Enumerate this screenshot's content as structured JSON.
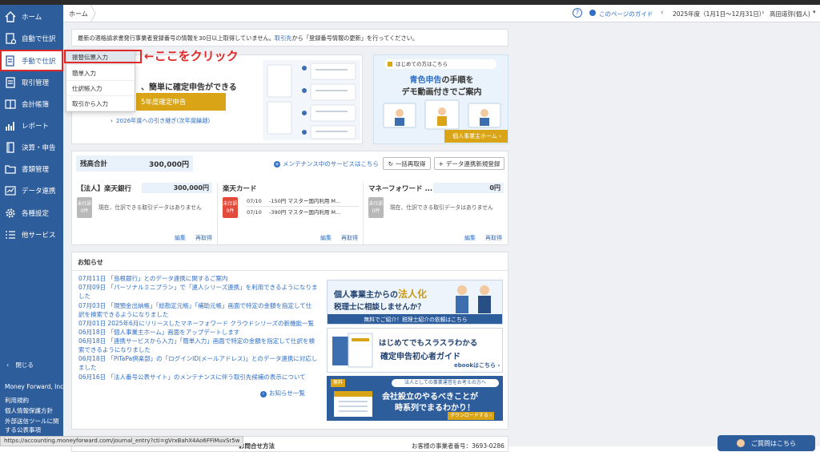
{
  "sidebar": {
    "items": [
      {
        "label": "ホーム",
        "icon": "home-icon"
      },
      {
        "label": "自動で仕訳",
        "icon": "auto-journal-icon"
      },
      {
        "label": "手動で仕訳",
        "icon": "manual-journal-icon"
      },
      {
        "label": "取引管理",
        "icon": "transaction-icon"
      },
      {
        "label": "会計帳簿",
        "icon": "ledger-icon"
      },
      {
        "label": "レポート",
        "icon": "report-icon"
      },
      {
        "label": "決算・申告",
        "icon": "settlement-icon"
      },
      {
        "label": "書類管理",
        "icon": "folder-icon"
      },
      {
        "label": "データ連携",
        "icon": "data-link-icon"
      },
      {
        "label": "各種設定",
        "icon": "gear-icon"
      },
      {
        "label": "他サービス",
        "icon": "list-icon"
      }
    ],
    "close_label": "閉じる",
    "company": "Money Forward, Inc.",
    "footer_links": [
      "利用規約",
      "個人情報保護方針",
      "外部送信ツールに関",
      "する公表事項"
    ]
  },
  "header": {
    "breadcrumb": "ホーム",
    "guide_label": "このページのガイド",
    "fiscal_year": "2025年度（1月1日〜12月31日）",
    "user": "高田道弥(個人)"
  },
  "notice": {
    "text_before": "最新の適格請求書発行事業者登録番号の情報を30日以上取得していません。",
    "link": "取引先",
    "text_after": "から「登録番号情報の更新」を行ってください。"
  },
  "dropdown": {
    "items": [
      "振替伝票入力",
      "簡単入力",
      "仕訳帳入力",
      "取引から入力"
    ]
  },
  "annotation": {
    "text": "←ここをクリック"
  },
  "tax_card": {
    "headline": "、簡単に確定申告ができる",
    "button": "5年度確定申告",
    "link": "2026年度への引き継ぎ(次年度繰越)"
  },
  "promo": {
    "tag": "はじめての方はこちら",
    "line1_hl": "青色申告",
    "line1_rest": "の手順を",
    "line2": "デモ動画付きでご案内",
    "button": "個人事業主ホーム ›"
  },
  "balance": {
    "label": "残高合計",
    "total": "300,000円",
    "maintenance": "メンテナンス中のサービスはこちら",
    "fetch_all": "一括再取得",
    "new_link": "データ連携新規登録"
  },
  "accounts": [
    {
      "name": "【法人】楽天銀行",
      "amount": "300,000円",
      "badge": [
        "未仕訳",
        "0件"
      ],
      "badge_color": "#b8b8b8",
      "rows": [],
      "message": "現在、仕訳できる取引データはありません",
      "edit": "編集",
      "refetch": "再取得"
    },
    {
      "name": "楽天カード",
      "amount": "",
      "badge": [
        "未仕訳",
        "9件"
      ],
      "badge_color": "#e24b3b",
      "rows": [
        {
          "date": "07/10",
          "desc": "-150円 マスター国内利用 M..."
        },
        {
          "date": "07/10",
          "desc": "-390円 マスター国内利用 M..."
        }
      ],
      "message": "",
      "edit": "編集",
      "refetch": "再取得"
    },
    {
      "name": "マネーフォワード ...",
      "amount": "0円",
      "badge": [
        "未仕訳",
        "0件"
      ],
      "badge_color": "#b8b8b8",
      "rows": [],
      "message": "現在、仕訳できる取引データはありません",
      "edit": "編集",
      "refetch": "再取得"
    }
  ],
  "news": {
    "title": "お知らせ",
    "items": [
      "07月11日 「島根銀行」とのデータ連携に関するご案内",
      "07月09日 「パーソナルミニプラン」で「連人シリーズ連携」を利用できるようになりま",
      "した",
      "07月03日 「現預金出納帳」「総勘定元帳」「補助元帳」画面で特定の金額を指定して仕",
      "訳を検索できるようになりました",
      "07月01日 2025年6月にリリースしたマネーフォワード クラウドシリーズの新機能一覧",
      "06月18日 「個人事業主ホーム」画面をアップデートします",
      "06月18日 「連携サービスから入力」「簡単入力」画面で特定の金額を指定して仕訳を検",
      "索できるようになりました",
      "06月18日 「PiTaPa倶楽部」の「ログインID(メールアドレス)」とのデータ連携に対応し",
      "ました",
      "06月16日 「法人番号公表サイト」のメンテナンスに伴う取引先候補の表示について"
    ],
    "more": "お知らせ一覧"
  },
  "ads": [
    {
      "l1a": "個人事業主からの",
      "l1b": "法人化",
      "l2": "税理士に相談しませんか？",
      "btn": "無料でご紹介！税理士紹介の依頼はこちら"
    },
    {
      "l1": "はじめてでもスラスラわかる",
      "l2": "確定申告初心者ガイド",
      "btn": "ebookはこちら ›"
    },
    {
      "tag": "無料",
      "top": "法人としての事業運営をお考えの方へ",
      "l1": "会社設立のやるべきことが",
      "l2": "時系列でまるわかり！",
      "btn": "ダウンロードする ›"
    }
  ],
  "bottom": {
    "left": "お問合せ方法",
    "right": "お客様の事業者番号：3693-0286"
  },
  "status_url": "https://accounting.moneyforward.com/journal_entry?cti=gVrxBahX4Ao6FFiMuvSr5w",
  "help_label": "ご質問はこちら",
  "colors": {
    "sidebar": "#2e5d9c",
    "accent": "#2f6fc6",
    "annotation": "#e02a2a",
    "gold": "#d9a516"
  }
}
